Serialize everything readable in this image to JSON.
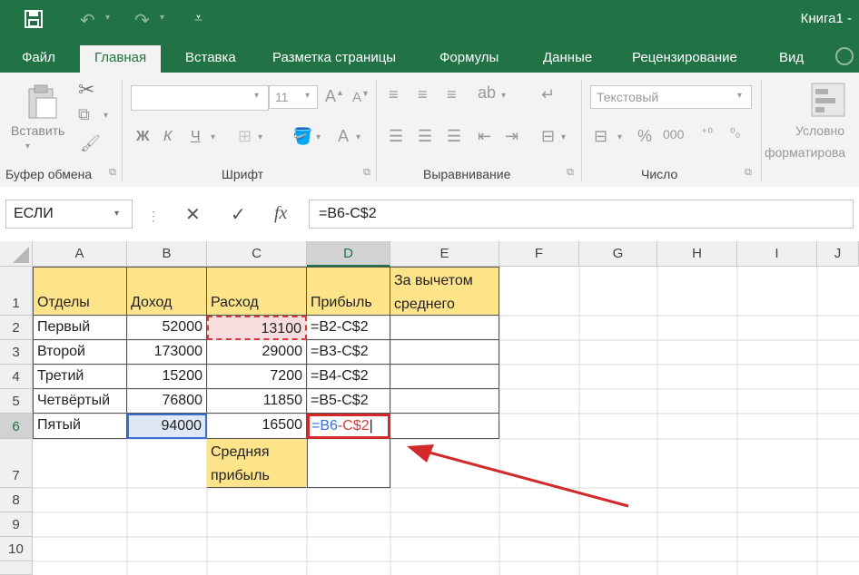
{
  "window": {
    "title": "Книга1 -"
  },
  "tabs": [
    {
      "label": "Файл"
    },
    {
      "label": "Главная"
    },
    {
      "label": "Вставка"
    },
    {
      "label": "Разметка страницы"
    },
    {
      "label": "Формулы"
    },
    {
      "label": "Данные"
    },
    {
      "label": "Рецензирование"
    },
    {
      "label": "Вид"
    }
  ],
  "ribbon": {
    "clipboard": {
      "paste_label": "Вставить",
      "group_label": "Буфер обмена"
    },
    "font": {
      "font_name": "",
      "font_size": "11",
      "bold": "Ж",
      "italic": "К",
      "underline": "Ч",
      "group_label": "Шрифт"
    },
    "alignment": {
      "group_label": "Выравнивание"
    },
    "number": {
      "format": "Текстовый",
      "group_label": "Число"
    },
    "styles": {
      "conditional_line1": "Условно",
      "conditional_line2": "форматирова"
    }
  },
  "formula_bar": {
    "name_box": "ЕСЛИ",
    "cancel": "✕",
    "enter": "✓",
    "fx": "fx",
    "formula": "=B6-C$2"
  },
  "columns": [
    "A",
    "B",
    "C",
    "D",
    "E",
    "F",
    "G",
    "H",
    "I",
    "J"
  ],
  "rows": [
    "1",
    "2",
    "3",
    "4",
    "5",
    "6",
    "7",
    "8",
    "9",
    "10"
  ],
  "headers": {
    "a1": "Отделы",
    "b1": "Доход",
    "c1": "Расход",
    "d1": "Прибыль",
    "e1_line1": "За вычетом",
    "e1_line2": "среднего"
  },
  "data": [
    {
      "dept": "Первый",
      "income": "52000",
      "expense": "13100",
      "profit": "=B2-C$2"
    },
    {
      "dept": "Второй",
      "income": "173000",
      "expense": "29000",
      "profit": "=B3-C$2"
    },
    {
      "dept": "Третий",
      "income": "15200",
      "expense": "7200",
      "profit": "=B4-C$2"
    },
    {
      "dept": "Четвёртый",
      "income": "76800",
      "expense": "11850",
      "profit": "=B5-C$2"
    },
    {
      "dept": "Пятый",
      "income": "94000",
      "expense": "16500",
      "profit_ref1": "=B6",
      "profit_ref2": "-C$2"
    }
  ],
  "avg_label": {
    "line1": "Средняя",
    "line2": "прибыль"
  },
  "colors": {
    "excel_green": "#217346",
    "yellow_fill": "#fde38a",
    "ref_blue": "#3a6fd8",
    "ref_red": "#d23c3c",
    "arrow_red": "#d22a2a"
  }
}
